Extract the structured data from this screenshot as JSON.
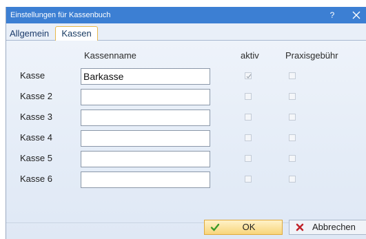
{
  "window": {
    "title": "Einstellungen für Kassenbuch",
    "help_label": "?"
  },
  "tabs": [
    {
      "label": "Allgemein",
      "active": false
    },
    {
      "label": "Kassen",
      "active": true
    }
  ],
  "columns": {
    "name": "Kassenname",
    "active": "aktiv",
    "fee": "Praxisgebühr"
  },
  "rows": [
    {
      "label": "Kasse",
      "name": "Barkasse",
      "aktiv": true,
      "praxisgebuehr": false
    },
    {
      "label": "Kasse 2",
      "name": "",
      "aktiv": false,
      "praxisgebuehr": false
    },
    {
      "label": "Kasse 3",
      "name": "",
      "aktiv": false,
      "praxisgebuehr": false
    },
    {
      "label": "Kasse 4",
      "name": "",
      "aktiv": false,
      "praxisgebuehr": false
    },
    {
      "label": "Kasse 5",
      "name": "",
      "aktiv": false,
      "praxisgebuehr": false
    },
    {
      "label": "Kasse 6",
      "name": "",
      "aktiv": false,
      "praxisgebuehr": false
    }
  ],
  "buttons": {
    "ok": "OK",
    "cancel": "Abbrechen"
  },
  "colors": {
    "titlebar": "#3c7fd3",
    "ok_accent": "#f8d57a",
    "check_green": "#3a9a2a",
    "cancel_red": "#c0232a"
  },
  "icons": {
    "ok": "checkmark-icon",
    "cancel": "x-mark-icon",
    "close": "close-icon"
  }
}
